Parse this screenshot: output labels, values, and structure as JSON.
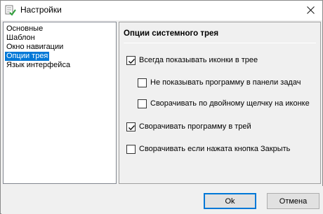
{
  "window": {
    "title": "Настройки",
    "app_icon": "settings-checklist-icon",
    "close_icon": "close-icon"
  },
  "nav": {
    "items": [
      {
        "label": "Основные",
        "selected": false
      },
      {
        "label": "Шаблон",
        "selected": false
      },
      {
        "label": "Окно навигации",
        "selected": false
      },
      {
        "label": "Опции трея",
        "selected": true
      },
      {
        "label": "Язык интерфейса",
        "selected": false
      }
    ]
  },
  "panel": {
    "header": "Опции системного трея",
    "options": [
      {
        "label": "Всегда показывать иконки в трее",
        "checked": true
      },
      {
        "label": "Не показывать программу в панели задач",
        "checked": false
      },
      {
        "label": "Сворачивать по двойному щелчку на иконке",
        "checked": false
      },
      {
        "label": "Сворачивать программу в трей",
        "checked": true
      },
      {
        "label": "Сворачивать если нажата кнопка Закрыть",
        "checked": false
      }
    ]
  },
  "buttons": {
    "ok_label": "Ok",
    "cancel_label": "Отмена"
  },
  "colors": {
    "selection": "#0078d7",
    "dialog_bg": "#f0f0f0"
  }
}
